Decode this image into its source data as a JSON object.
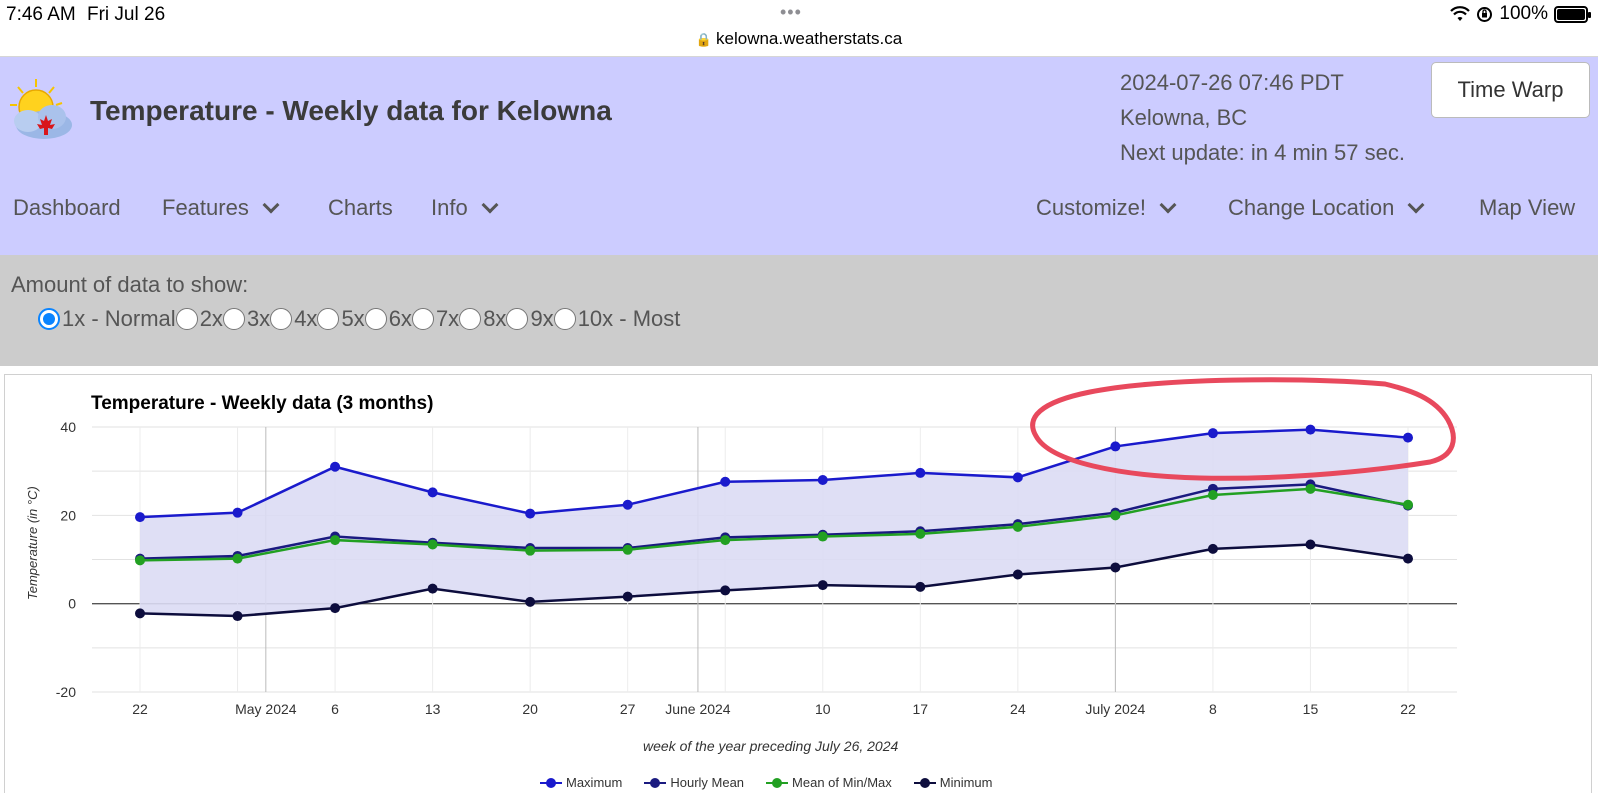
{
  "status_bar": {
    "time": "7:46 AM",
    "date": "Fri Jul 26",
    "dots": "•••",
    "battery": "100%",
    "url": "kelowna.weatherstats.ca"
  },
  "header": {
    "title": "Temperature - Weekly data for Kelowna",
    "datetime": "2024-07-26 07:46 PDT",
    "location": "Kelowna, BC",
    "next_update": "Next update: in 4 min 57 sec.",
    "time_warp": "Time Warp"
  },
  "nav": {
    "dashboard": "Dashboard",
    "features": "Features",
    "charts": "Charts",
    "info": "Info",
    "customize": "Customize!",
    "change_location": "Change Location",
    "map_view": "Map View"
  },
  "amount": {
    "label": "Amount of data to show:",
    "options": [
      "1x - Normal",
      "2x",
      "3x",
      "4x",
      "5x",
      "6x",
      "7x",
      "8x",
      "9x",
      "10x - Most"
    ],
    "selected": 0
  },
  "colors": {
    "maximum": "#1a1acc",
    "hourly_mean": "#1a1a80",
    "mean_min_max": "#22a022",
    "minimum": "#0d0d3d",
    "band_fill": "#dcdcf4",
    "annotation": "#e8495d"
  },
  "chart_data": {
    "type": "line",
    "title": "Temperature - Weekly data (3 months)",
    "xlabel": "week of the year preceding July 26, 2024",
    "ylabel": "Temperature (in °C)",
    "ylim": [
      -20,
      40
    ],
    "yticks": [
      40,
      20,
      0,
      -20
    ],
    "x": [
      "2024-04-22",
      "2024-04-29",
      "2024-05-06",
      "2024-05-13",
      "2024-05-20",
      "2024-05-27",
      "2024-06-03",
      "2024-06-10",
      "2024-06-17",
      "2024-06-24",
      "2024-07-01",
      "2024-07-08",
      "2024-07-15",
      "2024-07-22"
    ],
    "tick_labels": [
      "22",
      "",
      "6",
      "13",
      "20",
      "27",
      "",
      "10",
      "17",
      "24",
      "",
      "8",
      "15",
      "22"
    ],
    "month_labels": [
      "May 2024",
      "June 2024",
      "July 2024"
    ],
    "series": [
      {
        "name": "Maximum",
        "values": [
          19.6,
          20.6,
          31.0,
          25.2,
          20.4,
          22.4,
          27.6,
          28.0,
          29.6,
          28.6,
          35.6,
          38.6,
          39.4,
          37.6
        ]
      },
      {
        "name": "Hourly Mean",
        "values": [
          10.2,
          10.8,
          15.2,
          13.8,
          12.6,
          12.6,
          15.0,
          15.6,
          16.4,
          18.0,
          20.6,
          26.0,
          27.0,
          22.2
        ]
      },
      {
        "name": "Mean of Min/Max",
        "values": [
          9.8,
          10.2,
          14.4,
          13.4,
          12.0,
          12.2,
          14.4,
          15.2,
          15.8,
          17.4,
          20.0,
          24.6,
          26.0,
          22.4
        ]
      },
      {
        "name": "Minimum",
        "values": [
          -2.2,
          -2.8,
          -1.0,
          3.4,
          0.4,
          1.6,
          3.0,
          4.2,
          3.8,
          6.6,
          8.2,
          12.4,
          13.4,
          10.2
        ]
      }
    ],
    "legend_position": "bottom"
  }
}
